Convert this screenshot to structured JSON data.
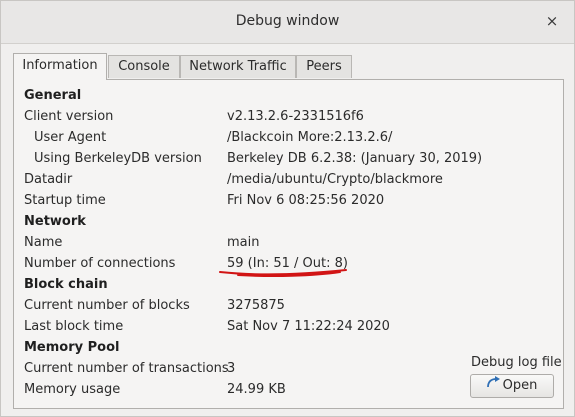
{
  "window": {
    "title": "Debug window",
    "close_glyph": "×"
  },
  "tabs": [
    {
      "label": "Information",
      "active": true
    },
    {
      "label": "Console",
      "active": false
    },
    {
      "label": "Network Traffic",
      "active": false
    },
    {
      "label": "Peers",
      "active": false
    }
  ],
  "info": {
    "general": {
      "heading": "General",
      "client_version_label": "Client version",
      "client_version": "v2.13.2.6-2331516f6",
      "user_agent_label": "User Agent",
      "user_agent": "/Blackcoin More:2.13.2.6/",
      "berkeley_label": "Using BerkeleyDB version",
      "berkeley": "Berkeley DB 6.2.38: (January 30, 2019)",
      "datadir_label": "Datadir",
      "datadir": "/media/ubuntu/Crypto/blackmore",
      "startup_label": "Startup time",
      "startup": "Fri Nov 6 08:25:56 2020"
    },
    "network": {
      "heading": "Network",
      "name_label": "Name",
      "name": "main",
      "connections_label": "Number of connections",
      "connections": "59 (In: 51 / Out: 8)"
    },
    "blockchain": {
      "heading": "Block chain",
      "blocks_label": "Current number of blocks",
      "blocks": "3275875",
      "last_block_label": "Last block time",
      "last_block": "Sat Nov 7 11:22:24 2020"
    },
    "mempool": {
      "heading": "Memory Pool",
      "tx_label": "Current number of transactions",
      "tx": "3",
      "usage_label": "Memory usage",
      "usage": "24.99 KB"
    }
  },
  "debug_log": {
    "label": "Debug log file",
    "open_button": "Open",
    "icon": "open-arrow-icon"
  },
  "colors": {
    "annotation_red": "#d11414",
    "icon_blue": "#2f6fb5"
  }
}
